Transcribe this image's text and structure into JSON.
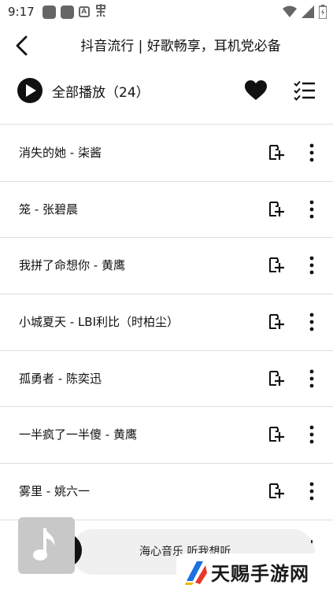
{
  "status_bar": {
    "time": "9:17",
    "left_icons": [
      "app-square-icon",
      "app-square-icon",
      "a-badge-icon",
      "notification-icon"
    ],
    "right_icons": [
      "wifi-icon",
      "signal-icon",
      "battery-charging-icon"
    ]
  },
  "header": {
    "title": "抖音流行 | 好歌畅享，耳机党必备",
    "back_icon": "back-arrow-icon"
  },
  "controls": {
    "play_all_label": "全部播放（24）",
    "favorite_icon": "heart-icon",
    "manage_icon": "checklist-icon"
  },
  "songs": [
    {
      "title": "消失的她 - 柒酱"
    },
    {
      "title": "笼 - 张碧晨"
    },
    {
      "title": "我拼了命想你 - 黄鹰"
    },
    {
      "title": "小城夏天 - LBI利比（时柏尘）"
    },
    {
      "title": "孤勇者 - 陈奕迅"
    },
    {
      "title": "一半疯了一半傻 - 黄鹰"
    },
    {
      "title": "雾里 - 姚六一"
    }
  ],
  "mini_player": {
    "now_playing": "海心音乐 听我想听",
    "cover_icon": "music-note-icon"
  },
  "watermark": {
    "text": "天赐手游网"
  },
  "colors": {
    "primary": "#111111",
    "divider": "#dddddd",
    "mini_player_bg": "#f0f0f0",
    "watermark_logo_blue": "#1e6fe0",
    "watermark_logo_red": "#e8362c"
  }
}
